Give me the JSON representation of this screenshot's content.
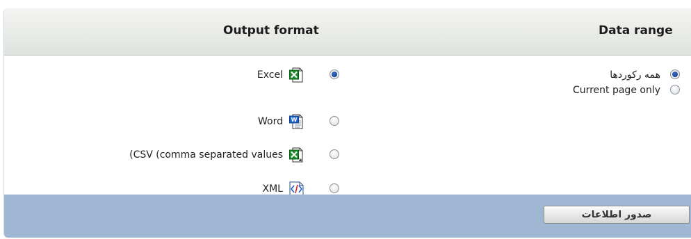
{
  "header": {
    "output_format_title": "Output format",
    "data_range_title": "Data range"
  },
  "output_format": {
    "options": [
      {
        "label": "Excel",
        "icon": "excel-file-icon",
        "checked": true
      },
      {
        "label": "Word",
        "icon": "word-file-icon",
        "checked": false
      },
      {
        "label": "(CSV (comma separated values",
        "icon": "csv-file-icon",
        "checked": false
      },
      {
        "label": "XML",
        "icon": "xml-file-icon",
        "checked": false
      }
    ]
  },
  "data_range": {
    "options": [
      {
        "label": "همه رکوردها",
        "checked": true
      },
      {
        "label": "Current page only",
        "checked": false
      }
    ]
  },
  "footer": {
    "export_button_label": "صدور اطلاعات"
  },
  "colors": {
    "footer_bg": "#9fb7d3",
    "header_bg": "#dfe2de",
    "radio_selected": "#1a3f8f"
  }
}
